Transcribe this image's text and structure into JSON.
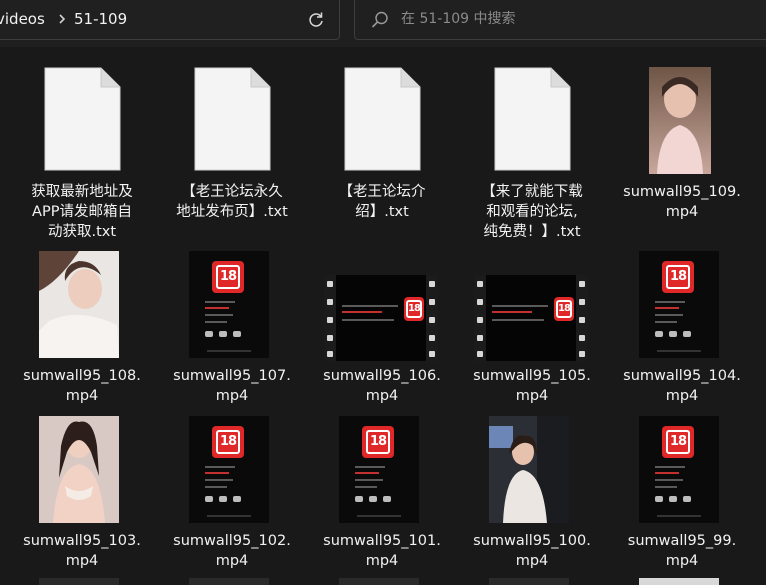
{
  "address_bar": {
    "crumbs": [
      "videos",
      "51-109"
    ]
  },
  "search": {
    "placeholder": "在 51-109 中搜索"
  },
  "colors": {
    "background": "#191919",
    "text": "#f2f2f2",
    "badge_red": "#e02828",
    "field_border": "#3d3d3d"
  },
  "files": [
    {
      "name": "获取最新地址及\nAPP请发邮箱自\n动获取.txt",
      "kind": "text-document"
    },
    {
      "name": "【老王论坛永久\n地址发布页】.txt",
      "kind": "text-document"
    },
    {
      "name": "【老王论坛介\n绍】.txt",
      "kind": "text-document"
    },
    {
      "name": "【来了就能下载\n和观看的论坛,\n纯免费！】.txt",
      "kind": "text-document"
    },
    {
      "name": "sumwall95_109.\nmp4",
      "kind": "video-photo"
    },
    {
      "name": "sumwall95_108.\nmp4",
      "kind": "video-photo"
    },
    {
      "name": "sumwall95_107.\nmp4",
      "kind": "video-promo"
    },
    {
      "name": "sumwall95_106.\nmp4",
      "kind": "video-filmstrip"
    },
    {
      "name": "sumwall95_105.\nmp4",
      "kind": "video-filmstrip"
    },
    {
      "name": "sumwall95_104.\nmp4",
      "kind": "video-promo"
    },
    {
      "name": "sumwall95_103.\nmp4",
      "kind": "video-photo"
    },
    {
      "name": "sumwall95_102.\nmp4",
      "kind": "video-promo"
    },
    {
      "name": "sumwall95_101.\nmp4",
      "kind": "video-promo"
    },
    {
      "name": "sumwall95_100.\nmp4",
      "kind": "video-photo"
    },
    {
      "name": "sumwall95_99.\nmp4",
      "kind": "video-promo"
    }
  ],
  "promo_badge_text": "18"
}
